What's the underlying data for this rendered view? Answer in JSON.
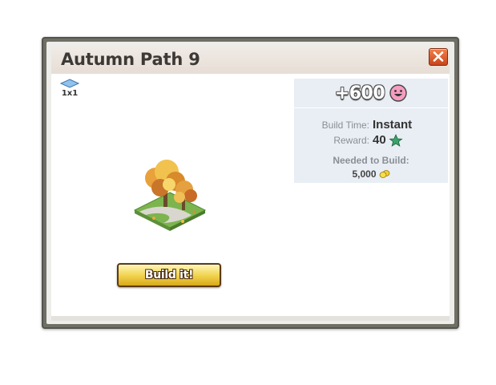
{
  "dialog": {
    "title": "Autumn Path 9",
    "close_icon": "close-icon"
  },
  "item": {
    "size": "1x1",
    "size_icon": "tile-icon",
    "image": "autumn-tree-path-tile"
  },
  "build_button": {
    "label": "Build it!"
  },
  "info": {
    "xp": "+600",
    "xp_icon": "pink-smiley-icon",
    "build_time_label": "Build Time:",
    "build_time_value": "Instant",
    "reward_label": "Reward:",
    "reward_value": "40",
    "reward_icon": "xp-star-icon",
    "needed_label": "Needed to Build:",
    "needed_value": "5,000",
    "needed_icon": "coin-icon"
  },
  "colors": {
    "frame": "#6f6f66",
    "title_bar": "#ede6e0",
    "info_panel": "#e8eef4",
    "button": "#f0d14a",
    "close_button": "#e0632f"
  }
}
